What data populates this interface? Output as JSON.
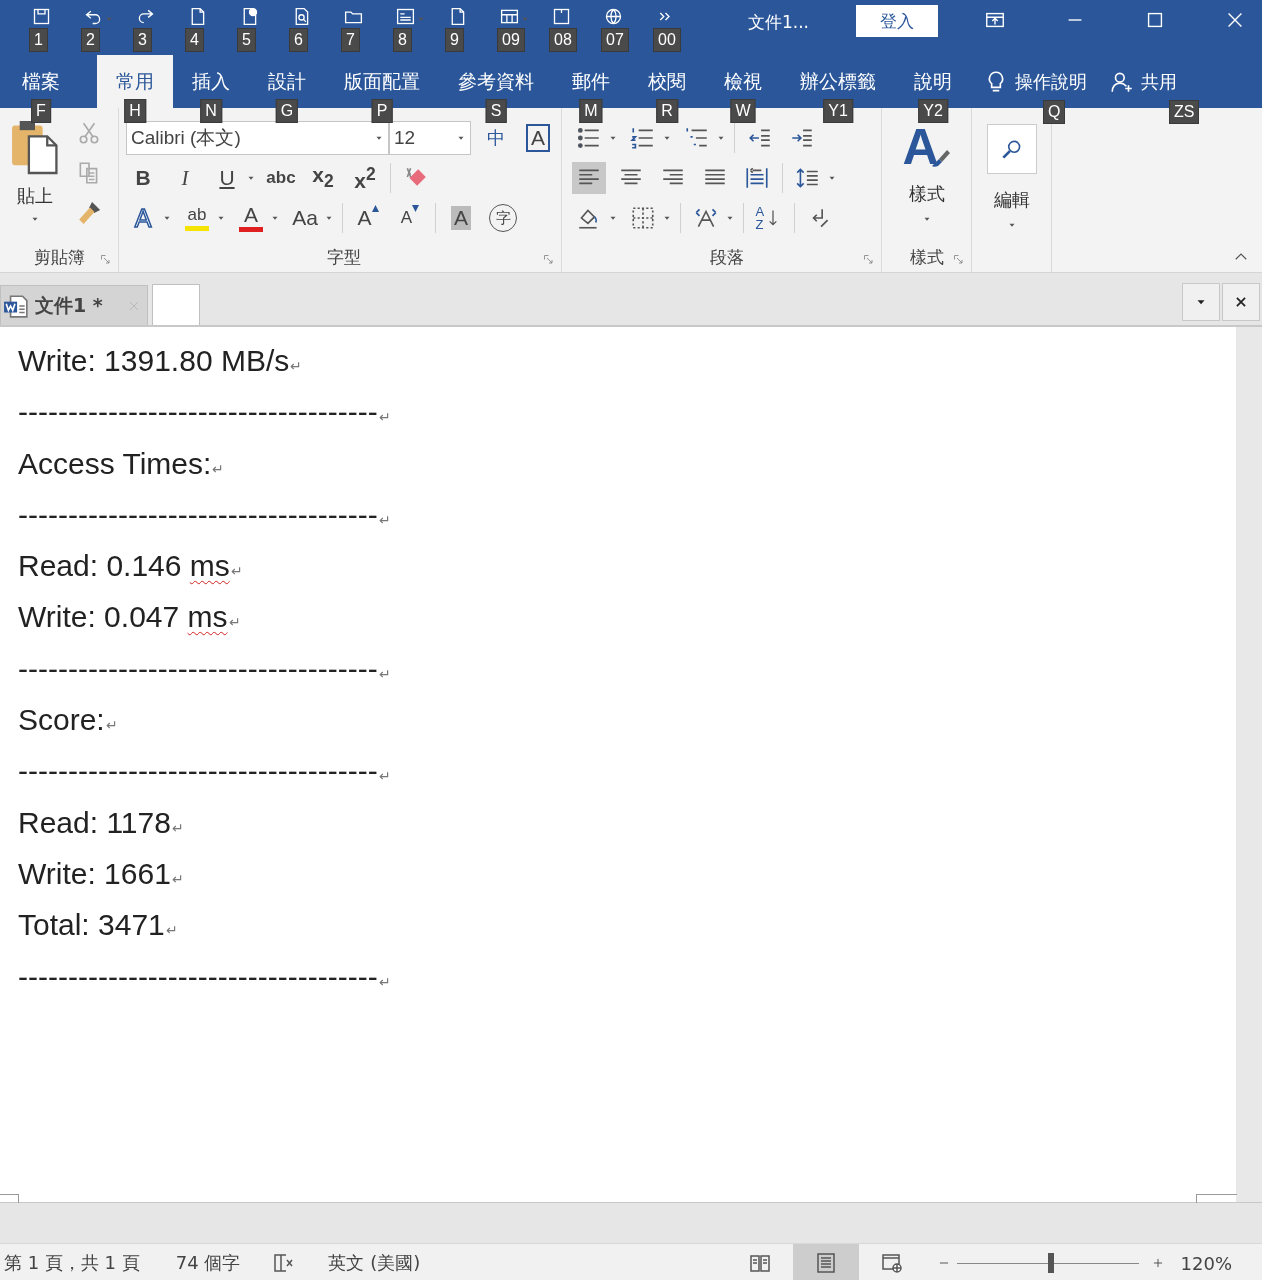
{
  "title_bar": {
    "quick_access": [
      {
        "kind": "save",
        "keytip": "1"
      },
      {
        "kind": "undo",
        "keytip": "2",
        "dropdown": true
      },
      {
        "kind": "redo",
        "keytip": "3"
      },
      {
        "kind": "page",
        "keytip": "4"
      },
      {
        "kind": "page-check",
        "keytip": "5"
      },
      {
        "kind": "preview",
        "keytip": "6"
      },
      {
        "kind": "folder",
        "keytip": "7"
      },
      {
        "kind": "form",
        "keytip": "8",
        "dropdown": true
      },
      {
        "kind": "page",
        "keytip": "9"
      },
      {
        "kind": "table",
        "keytip": "09",
        "dropdown": true
      },
      {
        "kind": "frame",
        "keytip": "08"
      },
      {
        "kind": "globe",
        "keytip": "07"
      },
      {
        "kind": "more",
        "keytip": "00"
      }
    ],
    "title": "文件1...",
    "sign_in": "登入"
  },
  "ribbon_tabs": [
    {
      "label": "檔案",
      "keytip": "F",
      "selected": false
    },
    {
      "label": "常用",
      "keytip": "H",
      "selected": true
    },
    {
      "label": "插入",
      "keytip": "N",
      "selected": false
    },
    {
      "label": "設計",
      "keytip": "G",
      "selected": false
    },
    {
      "label": "版面配置",
      "keytip": "P",
      "selected": false
    },
    {
      "label": "參考資料",
      "keytip": "S",
      "selected": false
    },
    {
      "label": "郵件",
      "keytip": "M",
      "selected": false
    },
    {
      "label": "校閱",
      "keytip": "R",
      "selected": false
    },
    {
      "label": "檢視",
      "keytip": "W",
      "selected": false
    },
    {
      "label": "辦公標籤",
      "keytip": "Y1",
      "selected": false
    },
    {
      "label": "說明",
      "keytip": "Y2",
      "selected": false
    }
  ],
  "tell_me": {
    "label": "操作說明",
    "keytip": "Q"
  },
  "share": {
    "label": "共用",
    "keytip": "ZS"
  },
  "ribbon": {
    "clipboard": {
      "paste": "貼上",
      "label": "剪貼簿"
    },
    "font": {
      "font_name": "Calibri (本文)",
      "font_size": "12",
      "label": "字型",
      "rows": [
        [
          {
            "kind": "phonetic",
            "glyph": "中"
          },
          {
            "kind": "char-border",
            "glyph": "A"
          }
        ],
        [
          {
            "kind": "bold",
            "glyph": "B"
          },
          {
            "kind": "italic",
            "glyph": "I"
          },
          {
            "kind": "underline",
            "glyph": "U",
            "dropdown": true
          },
          {
            "kind": "strike",
            "glyph": "abc"
          },
          {
            "kind": "subscript",
            "glyph": "x$_{2}$"
          },
          {
            "kind": "superscript",
            "glyph": "x$^{2}$"
          },
          {
            "kind": "sep"
          },
          {
            "kind": "clear"
          }
        ],
        [
          {
            "kind": "text-effect",
            "glyph": "A",
            "dropdown": true
          },
          {
            "kind": "highlight",
            "glyph": "ab",
            "dropdown": true
          },
          {
            "kind": "font-color",
            "glyph": "A",
            "dropdown": true
          },
          {
            "kind": "case",
            "glyph": "Aa",
            "dropdown": true
          },
          {
            "kind": "sep"
          },
          {
            "kind": "grow",
            "glyph": "A"
          },
          {
            "kind": "shrink",
            "glyph": "A"
          },
          {
            "kind": "sep"
          },
          {
            "kind": "shading-char",
            "glyph": "A"
          },
          {
            "kind": "enclose",
            "glyph": "字"
          }
        ]
      ]
    },
    "paragraph": {
      "label": "段落",
      "rows": [
        [
          {
            "kind": "bullets",
            "dropdown": true
          },
          {
            "kind": "numbering",
            "dropdown": true
          },
          {
            "kind": "multilevel",
            "dropdown": true
          },
          {
            "kind": "sep"
          },
          {
            "kind": "indent-decrease"
          },
          {
            "kind": "indent-increase"
          }
        ],
        [
          {
            "kind": "align-left",
            "selected": true
          },
          {
            "kind": "align-center",
            "selected": false
          },
          {
            "kind": "align-right",
            "selected": false
          },
          {
            "kind": "justify",
            "selected": false
          },
          {
            "kind": "distribute",
            "selected": false
          },
          {
            "kind": "sep"
          },
          {
            "kind": "line-spacing",
            "dropdown": true
          }
        ],
        [
          {
            "kind": "shading",
            "dropdown": true
          },
          {
            "kind": "borders",
            "dropdown": true
          },
          {
            "kind": "sep"
          },
          {
            "kind": "asian-layout",
            "dropdown": true
          },
          {
            "kind": "sep"
          },
          {
            "kind": "sort",
            "glyph": "AZ"
          },
          {
            "kind": "sep"
          },
          {
            "kind": "show-marks"
          }
        ]
      ]
    },
    "styles": {
      "glyph": "A",
      "button": "樣式",
      "label": "樣式"
    },
    "editing": {
      "button": "編輯"
    }
  },
  "doc_tabs": [
    {
      "label": "文件1 *"
    }
  ],
  "document": {
    "paragraphs": [
      {
        "segments": [
          {
            "text": "Write: 1391.80 MB/s"
          }
        ],
        "mark": "↵"
      },
      {
        "segments": [
          {
            "text": "------------------------------------"
          }
        ],
        "mark": "↵"
      },
      {
        "segments": [
          {
            "text": "Access Times:"
          }
        ],
        "mark": "↵"
      },
      {
        "segments": [
          {
            "text": "------------------------------------"
          }
        ],
        "mark": "↵"
      },
      {
        "segments": [
          {
            "text": "Read: 0.146 "
          },
          {
            "text": "ms",
            "misspelled": true
          }
        ],
        "mark": "↵"
      },
      {
        "segments": [
          {
            "text": "Write: 0.047 "
          },
          {
            "text": "ms",
            "misspelled": true
          }
        ],
        "mark": "↵"
      },
      {
        "segments": [
          {
            "text": "------------------------------------"
          }
        ],
        "mark": "↵"
      },
      {
        "segments": [
          {
            "text": "Score:"
          }
        ],
        "mark": "↵"
      },
      {
        "segments": [
          {
            "text": "------------------------------------"
          }
        ],
        "mark": "↵"
      },
      {
        "segments": [
          {
            "text": "Read: 1178"
          }
        ],
        "mark": "↵"
      },
      {
        "segments": [
          {
            "text": "Write: 1661"
          }
        ],
        "mark": "↵"
      },
      {
        "segments": [
          {
            "text": "Total: 3471"
          }
        ],
        "mark": "↵"
      },
      {
        "segments": [
          {
            "text": "------------------------------------"
          }
        ],
        "mark": "↵"
      }
    ]
  },
  "status_bar": {
    "page": "第 1 頁，共 1 頁",
    "words": "74 個字",
    "language": "英文 (美國)",
    "views": [
      {
        "kind": "read",
        "selected": false
      },
      {
        "kind": "print",
        "selected": true
      },
      {
        "kind": "web",
        "selected": false
      }
    ],
    "zoom": {
      "level": 0.52,
      "label": "120%"
    }
  }
}
